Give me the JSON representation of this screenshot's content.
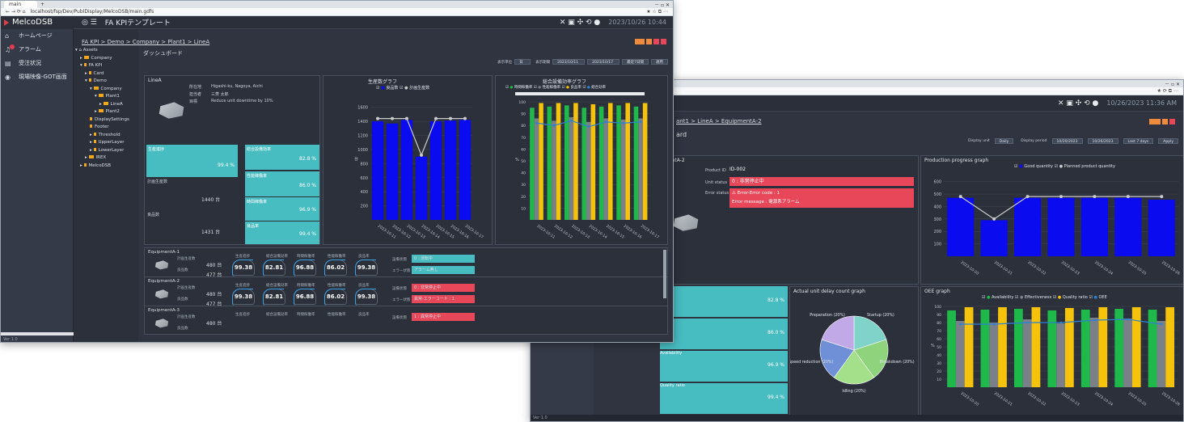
{
  "browser": {
    "tab_label": "main",
    "url": "localhost/fsp/Dev/PublDisplay/MelcoDSB/main.gdfs"
  },
  "app": {
    "brand": "MelcoDSB",
    "template_title": "FA KPIテンプレート",
    "timestamp": "2023/10/26 10:44",
    "breadcrumb": "FA KPI > Demo > Company > Plant1 > LineA",
    "page_title": "ダッシュボード",
    "version": "Ver 1.0"
  },
  "sidebar": {
    "items": [
      {
        "label": "ホームページ",
        "icon": "home-icon"
      },
      {
        "label": "アラーム",
        "icon": "bell-icon"
      },
      {
        "label": "受注状況",
        "icon": "document-icon"
      },
      {
        "label": "現場映像-GOT画面",
        "icon": "camera-icon"
      }
    ]
  },
  "tree": {
    "nodes": [
      "Assets",
      "Company",
      "FA KPI",
      "Card",
      "Demo",
      "Company",
      "Plant1",
      "LineA",
      "Plant2",
      "DisplaySettings",
      "Footer",
      "Threshold",
      "UpperLayer",
      "LowerLayer",
      "IREX",
      "MelcoDSB"
    ]
  },
  "toolbar_jp": {
    "period_label": "表示期間",
    "unit_label": "表示単位",
    "date_from": "2023/10/11",
    "date_to": "2023/10/17",
    "buttons": [
      "最近7日間",
      "適用"
    ]
  },
  "line_info": {
    "title": "LineA",
    "place_label": "所在地",
    "place": "Higashi-ku, Nagoya, Aichi",
    "owner_label": "担当者",
    "owner": "三菱 太郎",
    "goal_label": "目標",
    "goal": "Reduce unit downtime by 10%"
  },
  "kpis": [
    {
      "label": "生産進捗",
      "value": "99.4 %"
    },
    {
      "label": "総合設備効率",
      "value": "82.8 %"
    },
    {
      "label": "計画生産数",
      "value": "1440 台"
    },
    {
      "label": "性能稼働率",
      "value": "86.0 %"
    },
    {
      "label": "時間稼働率",
      "value": "96.9 %"
    },
    {
      "label": "良品数",
      "value": "1431 台"
    },
    {
      "label": "良品率",
      "value": "99.4 %"
    }
  ],
  "production_chart_jp": {
    "title": "生産数グラフ",
    "legend": [
      "良品数",
      "計画生産数"
    ]
  },
  "oee_chart_jp": {
    "title": "総合設備効率グラフ",
    "legend": [
      "時間稼働率",
      "性能稼働率",
      "良品率",
      "総合効率"
    ]
  },
  "equipment": [
    {
      "name": "EquipmentA-1",
      "plan": "480 台",
      "good": "477 台",
      "progress": "99.38",
      "oee": "82.81",
      "avail": "96.88",
      "perf": "86.02",
      "quality": "99.38",
      "status": "0 : 運転中",
      "error": "アラーム無し",
      "status_color": "#47bcc1"
    },
    {
      "name": "EquipmentA-2",
      "plan": "480 台",
      "good": "477 台",
      "progress": "99.38",
      "oee": "82.81",
      "avail": "96.88",
      "perf": "86.02",
      "quality": "99.38",
      "status": "0 : 非常停止中",
      "error": "異常-エラーコード : 1",
      "status_color": "#e8475a"
    },
    {
      "name": "EquipmentA-3",
      "plan": "480 台",
      "good": "",
      "progress": "",
      "oee": "",
      "avail": "",
      "perf": "",
      "quality": "",
      "status": "1 : 異常停止中",
      "error": "",
      "status_color": "#e8475a"
    }
  ],
  "equip_headers": {
    "plan": "計画生産数",
    "good": "良品数",
    "progress": "生産進捗",
    "oee": "総合設備効率",
    "avail": "時間稼働率",
    "perf": "性能稼働率",
    "quality": "良品率",
    "status": "設備状態",
    "error": "エラー状態"
  },
  "window2": {
    "breadcrumb": "ant1 > LineA > EquipmentA-2",
    "page_title": "ard",
    "timestamp": "10/26/2023 11:36 AM",
    "toolbar": {
      "unit_label": "Display unit",
      "unit_value": "Daily",
      "period_label": "Display period",
      "date_from": "10/20/2023",
      "date_to": "10/26/2023",
      "buttons": [
        "Last 7 days",
        "Apply"
      ]
    },
    "equip_title": "mentA-2",
    "product_id_label": "Product ID",
    "product_id": "ID-002",
    "unit_status_label": "Unit status",
    "unit_status": "0 : 非常停止中",
    "error_status_label": "Error status",
    "error_code": "Error-Error code : 1",
    "error_message": "Error message : 電源系アラーム",
    "kpis": [
      {
        "label": "",
        "value": "82.8 %"
      },
      {
        "label": "ance",
        "value": "86.0 %"
      },
      {
        "label": "Availability",
        "value": "96.9 %"
      },
      {
        "label": "Quality ratio",
        "value": "99.4 %"
      }
    ],
    "production_chart": {
      "title": "Production progress graph",
      "legend": [
        "Good quantity",
        "Planned product quantity"
      ]
    },
    "pie_chart": {
      "title": "Actual unit delay count graph",
      "labels": [
        "Startup (20%)",
        "Breakdown (20%)",
        "Idling (20%)",
        "Speed reduction (20%)",
        "Preparation (20%)"
      ]
    },
    "oee_chart": {
      "title": "OEE graph",
      "legend": [
        "Availability",
        "Effectiveness",
        "Quality ratio",
        "OEE"
      ]
    },
    "version": "Ver 1.0"
  },
  "chart_data": [
    {
      "type": "bar",
      "title": "生産数グラフ",
      "categories": [
        "2023-10-11",
        "2023-10-12",
        "2023-10-13",
        "2023-10-14",
        "2023-10-15",
        "2023-10-16",
        "2023-10-17"
      ],
      "series": [
        {
          "name": "良品数",
          "values": [
            1400,
            1370,
            1420,
            900,
            1400,
            1410,
            1420
          ],
          "color": "#0b0bf0"
        },
        {
          "name": "計画生産数",
          "values": [
            1440,
            1440,
            1440,
            920,
            1440,
            1440,
            1440
          ],
          "color": "#cccccc"
        }
      ],
      "ylim": [
        0,
        1700
      ],
      "ylabel": "台"
    },
    {
      "type": "bar",
      "title": "総合設備効率グラフ",
      "categories": [
        "2023-10-11",
        "2023-10-12",
        "2023-10-13",
        "2023-10-14",
        "2023-10-15",
        "2023-10-16",
        "2023-10-17"
      ],
      "series": [
        {
          "name": "時間稼働率",
          "values": [
            95,
            96,
            97,
            95,
            96,
            97,
            96
          ],
          "color": "#1fb84a"
        },
        {
          "name": "性能稼働率",
          "values": [
            86,
            84,
            87,
            83,
            86,
            85,
            86
          ],
          "color": "#7a7f88"
        },
        {
          "name": "良品率",
          "values": [
            99,
            99,
            99,
            98,
            99,
            99,
            99
          ],
          "color": "#f5c20c"
        },
        {
          "name": "総合効率",
          "values": [
            82,
            80,
            84,
            79,
            83,
            82,
            83
          ],
          "color": "#2f80d1"
        }
      ],
      "ylim": [
        0,
        100
      ],
      "ylabel": "%"
    },
    {
      "type": "bar",
      "title": "Production progress graph",
      "categories": [
        "2023-10-20",
        "2023-10-21",
        "2023-10-22",
        "2023-10-23",
        "2023-10-24",
        "2023-10-25",
        "2023-10-26"
      ],
      "series": [
        {
          "name": "Good quantity",
          "values": [
            470,
            290,
            470,
            470,
            470,
            470,
            455
          ],
          "color": "#0b0bf0"
        },
        {
          "name": "Planned product quantity",
          "values": [
            480,
            300,
            480,
            480,
            480,
            480,
            480
          ],
          "color": "#cccccc"
        }
      ],
      "ylim": [
        0,
        650
      ]
    },
    {
      "type": "pie",
      "title": "Actual unit delay count graph",
      "labels": [
        "Startup (20%)",
        "Breakdown (20%)",
        "Idling (20%)",
        "Speed reduction (20%)",
        "Preparation (20%)"
      ],
      "values": [
        20,
        20,
        20,
        20,
        20
      ],
      "colors": [
        "#7fd3c8",
        "#8fd47d",
        "#a4e08a",
        "#6f8fd6",
        "#c1a8e6"
      ]
    },
    {
      "type": "bar",
      "title": "OEE graph",
      "categories": [
        "2023-10-20",
        "2023-10-21",
        "2023-10-22",
        "2023-10-23",
        "2023-10-24",
        "2023-10-25",
        "2023-10-26"
      ],
      "series": [
        {
          "name": "Availability",
          "values": [
            95,
            96,
            97,
            95,
            96,
            97,
            96
          ],
          "color": "#1fb84a"
        },
        {
          "name": "Effectiveness",
          "values": [
            82,
            80,
            84,
            79,
            86,
            85,
            82
          ],
          "color": "#7a7f88"
        },
        {
          "name": "Quality ratio",
          "values": [
            99,
            99,
            99,
            98,
            99,
            99,
            99
          ],
          "color": "#f5c20c"
        },
        {
          "name": "OEE",
          "values": [
            78,
            78,
            80,
            80,
            83,
            84,
            78
          ],
          "color": "#2f80d1"
        }
      ],
      "ylim": [
        0,
        100
      ],
      "ylabel": "%"
    }
  ]
}
